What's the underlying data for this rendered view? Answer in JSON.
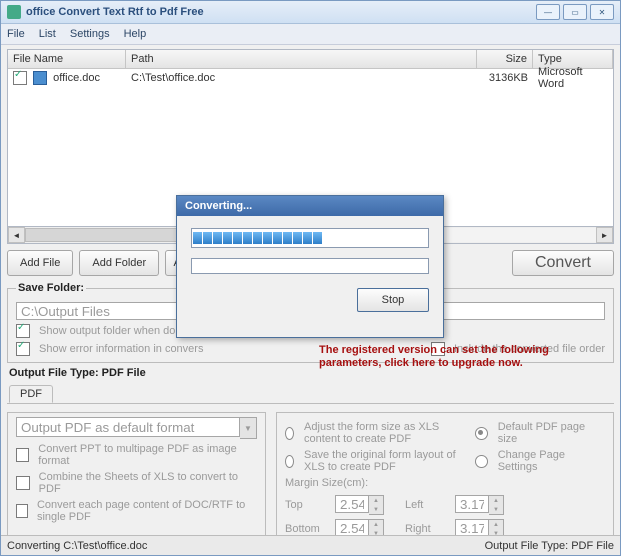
{
  "window": {
    "title": "office Convert Text Rtf to Pdf Free"
  },
  "menu": {
    "file": "File",
    "list": "List",
    "settings": "Settings",
    "help": "Help"
  },
  "columns": {
    "name": "File Name",
    "path": "Path",
    "size": "Size",
    "type": "Type"
  },
  "files": [
    {
      "name": "office.doc",
      "path": "C:\\Test\\office.doc",
      "size": "3136KB",
      "type": "Microsoft Word"
    }
  ],
  "buttons": {
    "addfile": "Add File",
    "addfolder": "Add Folder",
    "a": "A",
    "convert": "Convert"
  },
  "savefolder": {
    "legend": "Save Folder:",
    "path": "C:\\Output Files",
    "showoutput": "Show output folder when done",
    "showerror": "Show error information in convers",
    "includeorder": "Include the converted file order"
  },
  "reg_msg": "The registered version can set the following parameters, click here to upgrade now.",
  "outtype": {
    "label": "Output File Type:  PDF File",
    "tab": "PDF"
  },
  "left": {
    "combo": "Output PDF as default format",
    "opt1": "Convert PPT to multipage PDF as image format",
    "opt2": "Combine the Sheets of XLS to convert to PDF",
    "opt3": "Convert each page content of DOC/RTF to single PDF"
  },
  "right": {
    "r1": "Adjust the form size as XLS content to create PDF",
    "r2": "Save the original form layout of XLS to create PDF",
    "d1": "Default PDF page size",
    "d2": "Change Page Settings",
    "marginlabel": "Margin Size(cm):",
    "top": "Top",
    "left": "Left",
    "bottom": "Bottom",
    "right": "Right",
    "vtop": "2.54",
    "vleft": "3.17",
    "vbottom": "2.54",
    "vright": "3.17"
  },
  "status": {
    "left": "Converting  C:\\Test\\office.doc",
    "right": "Output File Type:  PDF File"
  },
  "modal": {
    "title": "Converting...",
    "stop": "Stop"
  },
  "glyph": {
    "min": "—",
    "max": "▭",
    "close": "✕",
    "left": "◄",
    "right": "►",
    "down": "▼",
    "up": "▲"
  }
}
